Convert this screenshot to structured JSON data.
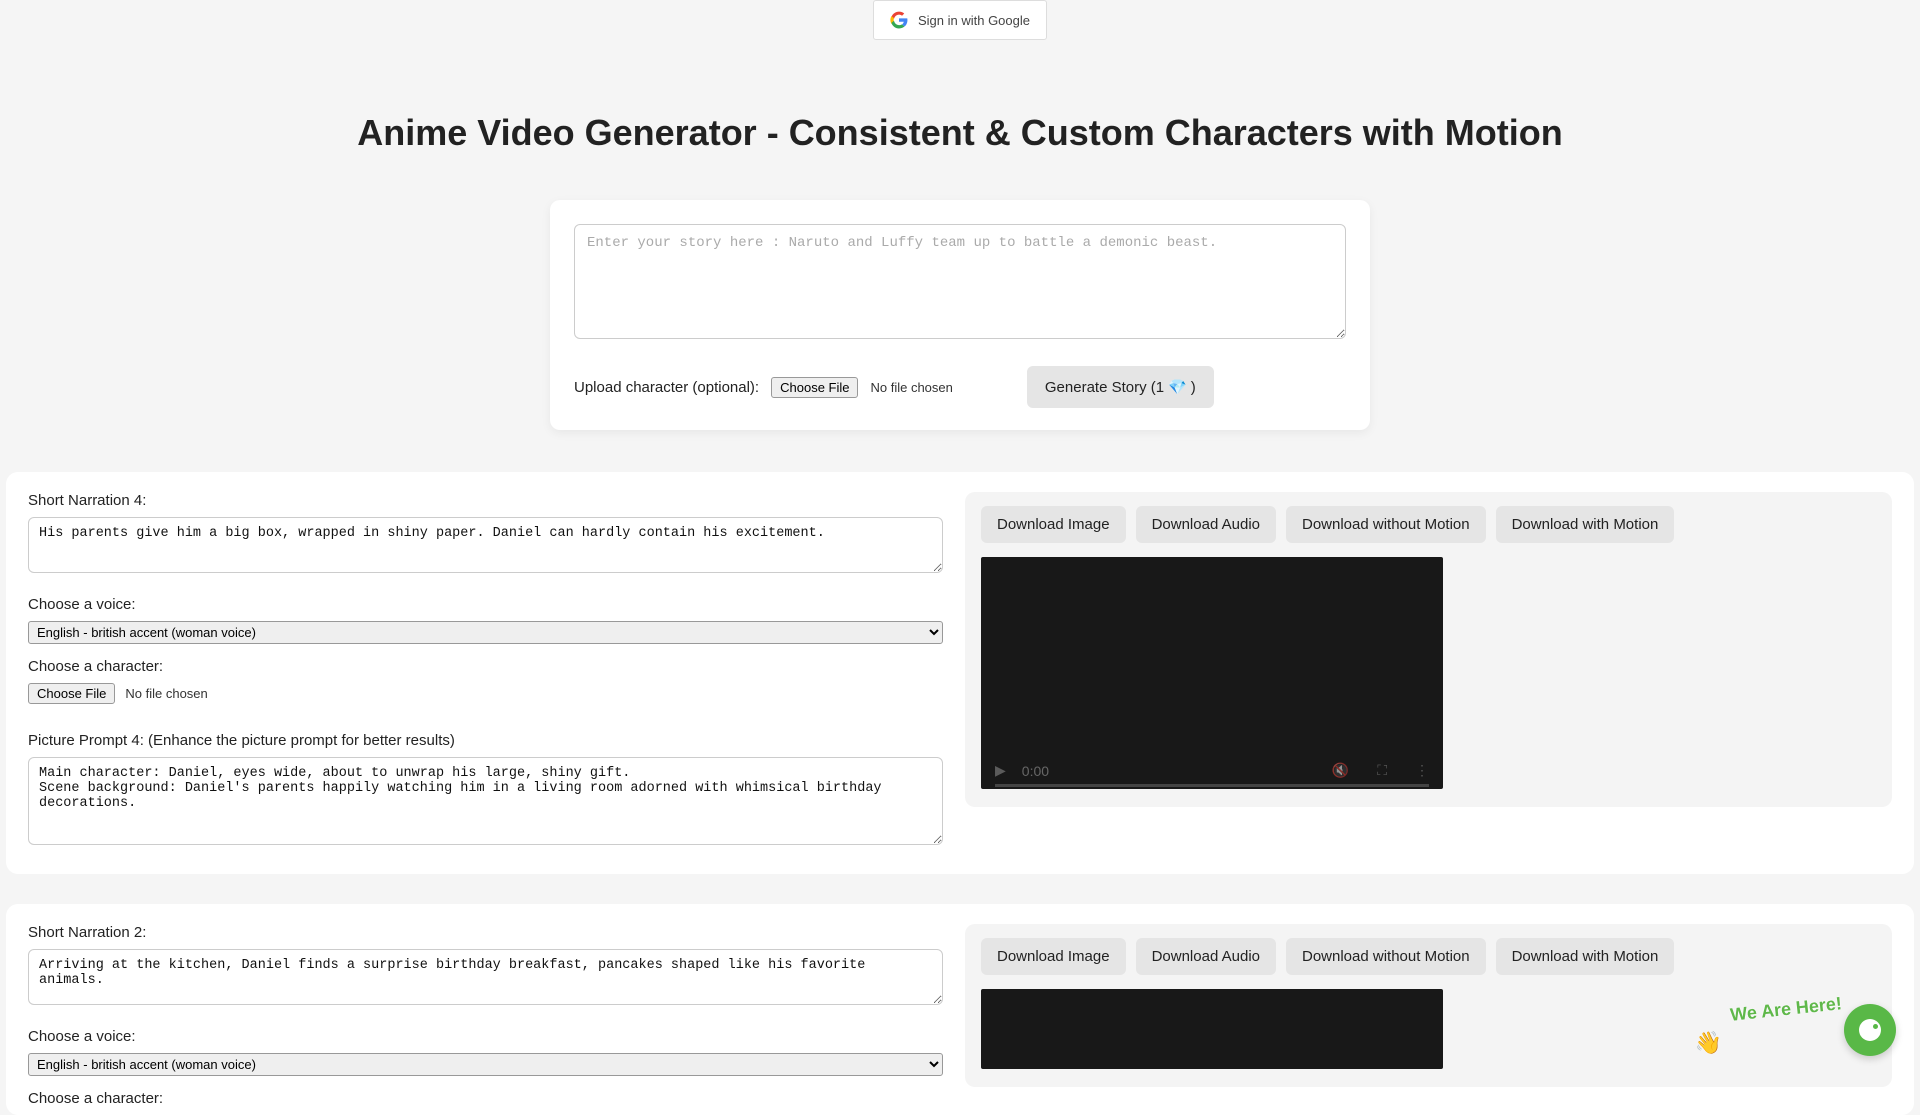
{
  "header": {
    "signin_label": "Sign in with Google"
  },
  "page": {
    "title": "Anime Video Generator - Consistent & Custom Characters with Motion"
  },
  "story_form": {
    "placeholder": "Enter your story here : Naruto and Luffy team up to battle a demonic beast.",
    "upload_label": "Upload character (optional):",
    "choose_file_label": "Choose File",
    "no_file_label": "No file chosen",
    "generate_label_prefix": "Generate Story (1 ",
    "generate_label_suffix": ")",
    "gem_emoji": "💎"
  },
  "voice": {
    "label": "Choose a voice:",
    "option_label": "English - british accent (woman voice)"
  },
  "character": {
    "label": "Choose a character:",
    "choose_file_label": "Choose File",
    "no_file_label": "No file chosen"
  },
  "downloads": {
    "image": "Download Image",
    "audio": "Download Audio",
    "without_motion": "Download without Motion",
    "with_motion": "Download with Motion"
  },
  "video": {
    "time": "0:00"
  },
  "sections": [
    {
      "narration_label": "Short Narration 4:",
      "narration_value": "His parents give him a big box, wrapped in shiny paper. Daniel can hardly contain his excitement.",
      "picture_label": "Picture Prompt 4: (Enhance the picture prompt for better results)",
      "picture_value": "Main character: Daniel, eyes wide, about to unwrap his large, shiny gift.\nScene background: Daniel's parents happily watching him in a living room adorned with whimsical birthday decorations."
    },
    {
      "narration_label": "Short Narration 2:",
      "narration_value": "Arriving at the kitchen, Daniel finds a surprise birthday breakfast, pancakes shaped like his favorite animals.",
      "picture_label": "",
      "picture_value": ""
    }
  ],
  "chat": {
    "text": "We Are Here!"
  }
}
